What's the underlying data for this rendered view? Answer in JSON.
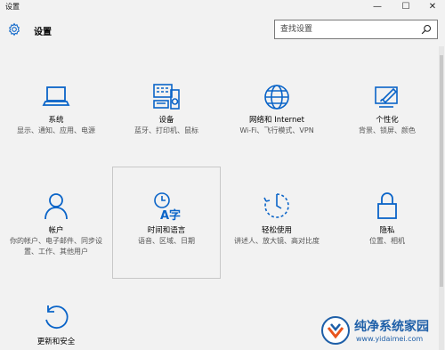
{
  "window": {
    "title": "设置",
    "minimize": "—",
    "maximize": "☐",
    "close": "✕"
  },
  "header": {
    "title": "设置",
    "icon": "gear-icon"
  },
  "search": {
    "placeholder": "查找设置",
    "value": ""
  },
  "accent": "#0a64c8",
  "tiles": [
    {
      "name": "系统",
      "desc": "显示、通知、应用、电源",
      "icon": "laptop-icon"
    },
    {
      "name": "设备",
      "desc": "蓝牙、打印机、鼠标",
      "icon": "devices-icon"
    },
    {
      "name": "网络和 Internet",
      "desc": "Wi-Fi、飞行模式、VPN",
      "icon": "globe-icon"
    },
    {
      "name": "个性化",
      "desc": "背景、锁屏、颜色",
      "icon": "paint-icon"
    },
    {
      "name": "帐户",
      "desc": "你的帐户、电子邮件、同步设置、工作、其他用户",
      "icon": "person-icon"
    },
    {
      "name": "时间和语言",
      "desc": "语音、区域、日期",
      "icon": "time-language-icon"
    },
    {
      "name": "轻松使用",
      "desc": "讲述人、放大镜、高对比度",
      "icon": "ease-of-access-icon"
    },
    {
      "name": "隐私",
      "desc": "位置、相机",
      "icon": "lock-icon"
    },
    {
      "name": "更新和安全",
      "desc": "",
      "icon": "refresh-icon"
    }
  ],
  "watermark": {
    "name": "纯净系统家园",
    "url": "www.yidaimei.com"
  }
}
